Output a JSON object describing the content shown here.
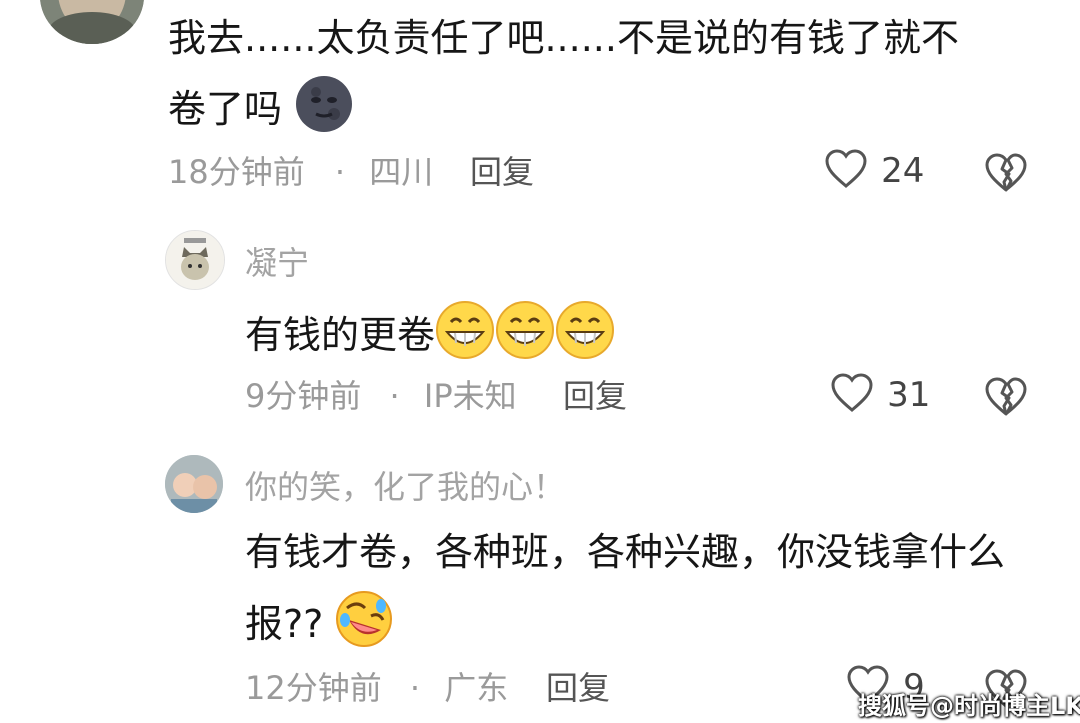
{
  "comments": [
    {
      "text_line1": "我去......太负责任了吧......不是说的有钱了就不",
      "text_line2": "卷了吗",
      "time": "18分钟前",
      "location": "四川",
      "reply_label": "回复",
      "likes": "24"
    },
    {
      "username": "凝宁",
      "text": "有钱的更卷",
      "time": "9分钟前",
      "location": "IP未知",
      "reply_label": "回复",
      "likes": "31"
    },
    {
      "username": "你的笑，化了我的心！",
      "text_line1": "有钱才卷，各种班，各种兴趣，你没钱拿什么",
      "text_line2": "报??",
      "time": "12分钟前",
      "location": "广东",
      "reply_label": "回复",
      "likes": "9"
    }
  ],
  "meta_separator": "·",
  "watermark": "搜狐号@时尚博主LK",
  "icons": {
    "like": "heart-outline-icon",
    "dislike": "broken-heart-icon"
  }
}
